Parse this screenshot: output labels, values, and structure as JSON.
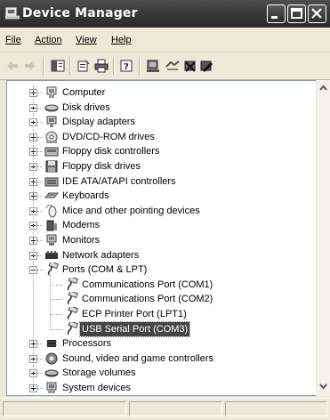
{
  "window": {
    "title": "Device Manager"
  },
  "menu": [
    {
      "label": "File",
      "name": "menu-file"
    },
    {
      "label": "Action",
      "name": "menu-action"
    },
    {
      "label": "View",
      "name": "menu-view"
    },
    {
      "label": "Help",
      "name": "menu-help"
    }
  ],
  "toolbar": {
    "icons": [
      "back-arrow-icon",
      "forward-arrow-icon",
      "show-hide-tree-icon",
      "properties-icon",
      "print-icon",
      "help-icon",
      "scan-hardware-icon",
      "update-driver-icon",
      "uninstall-icon",
      "disable-icon"
    ]
  },
  "tree": {
    "categories": [
      {
        "label": "Computer",
        "icon": "computer-icon",
        "expanded": false
      },
      {
        "label": "Disk drives",
        "icon": "disk-drive-icon",
        "expanded": false
      },
      {
        "label": "Display adapters",
        "icon": "display-adapter-icon",
        "expanded": false
      },
      {
        "label": "DVD/CD-ROM drives",
        "icon": "cdrom-icon",
        "expanded": false
      },
      {
        "label": "Floppy disk controllers",
        "icon": "floppy-controller-icon",
        "expanded": false
      },
      {
        "label": "Floppy disk drives",
        "icon": "floppy-drive-icon",
        "expanded": false
      },
      {
        "label": "IDE ATA/ATAPI controllers",
        "icon": "ide-controller-icon",
        "expanded": false
      },
      {
        "label": "Keyboards",
        "icon": "keyboard-icon",
        "expanded": false
      },
      {
        "label": "Mice and other pointing devices",
        "icon": "mouse-icon",
        "expanded": false
      },
      {
        "label": "Modems",
        "icon": "modem-icon",
        "expanded": false
      },
      {
        "label": "Monitors",
        "icon": "monitor-icon",
        "expanded": false
      },
      {
        "label": "Network adapters",
        "icon": "network-adapter-icon",
        "expanded": false
      },
      {
        "label": "Ports (COM & LPT)",
        "icon": "port-icon",
        "expanded": true,
        "children": [
          {
            "label": "Communications Port (COM1)",
            "icon": "port-icon",
            "selected": false
          },
          {
            "label": "Communications Port (COM2)",
            "icon": "port-icon",
            "selected": false
          },
          {
            "label": "ECP Printer Port (LPT1)",
            "icon": "port-icon",
            "selected": false
          },
          {
            "label": "USB Serial Port (COM3)",
            "icon": "port-icon",
            "selected": true
          }
        ]
      },
      {
        "label": "Processors",
        "icon": "processor-icon",
        "expanded": false
      },
      {
        "label": "Sound, video and game controllers",
        "icon": "sound-icon",
        "expanded": false
      },
      {
        "label": "Storage volumes",
        "icon": "storage-volume-icon",
        "expanded": false
      },
      {
        "label": "System devices",
        "icon": "system-device-icon",
        "expanded": false
      }
    ]
  },
  "colors": {
    "titlebar": "#3a3a3a",
    "selection": "#444444",
    "border": "#7f9db9"
  }
}
